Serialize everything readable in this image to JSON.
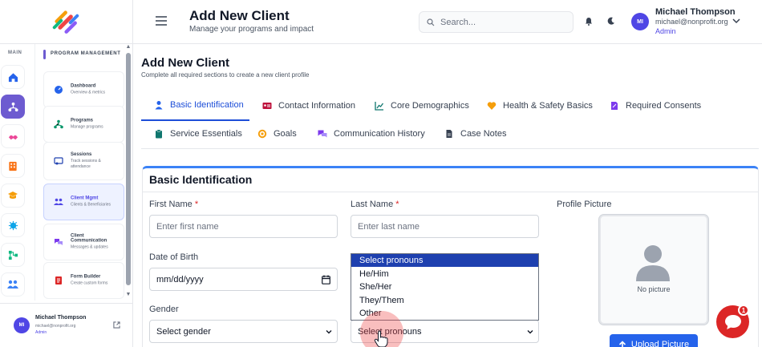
{
  "colors": {
    "accent": "#4f46e5",
    "primary": "#2563eb",
    "brand_purple": "#6d5bd0",
    "danger": "#dc2626"
  },
  "sidebar": {
    "rail_label": "MAIN",
    "section_title": "PROGRAM MANAGEMENT",
    "items": [
      {
        "title": "Dashboard",
        "subtitle": "Overview & metrics",
        "icon": "dashboard-icon"
      },
      {
        "title": "Programs",
        "subtitle": "Manage programs",
        "icon": "programs-icon"
      },
      {
        "title": "Sessions",
        "subtitle": "Track sessions & attendance",
        "icon": "sessions-icon"
      },
      {
        "title": "Client Mgmt",
        "subtitle": "Clients & Beneficiaries",
        "icon": "clients-icon"
      },
      {
        "title": "Client Communication",
        "subtitle": "Messages & updates",
        "icon": "communication-icon"
      },
      {
        "title": "Form Builder",
        "subtitle": "Create custom forms",
        "icon": "form-builder-icon"
      }
    ],
    "user": {
      "initials": "MI",
      "name": "Michael Thompson",
      "email": "michael@nonprofit.org",
      "role": "Admin"
    }
  },
  "header": {
    "title": "Add New Client",
    "subtitle": "Manage your programs and impact",
    "search_placeholder": "Search...",
    "user": {
      "initials": "MI",
      "name": "Michael Thompson",
      "email": "michael@nonprofit.org",
      "role": "Admin"
    }
  },
  "page": {
    "title": "Add New Client",
    "subtitle": "Complete all required sections to create a new client profile"
  },
  "tabs": [
    {
      "label": "Basic Identification",
      "icon": "user-icon"
    },
    {
      "label": "Contact Information",
      "icon": "id-card-icon"
    },
    {
      "label": "Core Demographics",
      "icon": "chart-icon"
    },
    {
      "label": "Health & Safety Basics",
      "icon": "heart-icon"
    },
    {
      "label": "Required Consents",
      "icon": "signature-icon"
    },
    {
      "label": "Service Essentials",
      "icon": "clipboard-icon"
    },
    {
      "label": "Goals",
      "icon": "target-icon"
    },
    {
      "label": "Communication History",
      "icon": "chat-bubbles-icon"
    },
    {
      "label": "Case Notes",
      "icon": "file-icon"
    }
  ],
  "form": {
    "section_title": "Basic Identification",
    "first_name": {
      "label": "First Name",
      "required": "*",
      "placeholder": "Enter first name"
    },
    "last_name": {
      "label": "Last Name",
      "required": "*",
      "placeholder": "Enter last name"
    },
    "dob": {
      "label": "Date of Birth",
      "value": "mm/dd/yyyy"
    },
    "gender": {
      "label": "Gender",
      "value": "Select gender"
    },
    "pronouns": {
      "value": "Select pronouns",
      "options": [
        "Select pronouns",
        "He/Him",
        "She/Her",
        "They/Them",
        "Other"
      ]
    },
    "profile_picture": {
      "label": "Profile Picture",
      "empty_text": "No picture",
      "upload_label": "Upload Picture"
    }
  },
  "chat_widget": {
    "badge_count": "1"
  }
}
